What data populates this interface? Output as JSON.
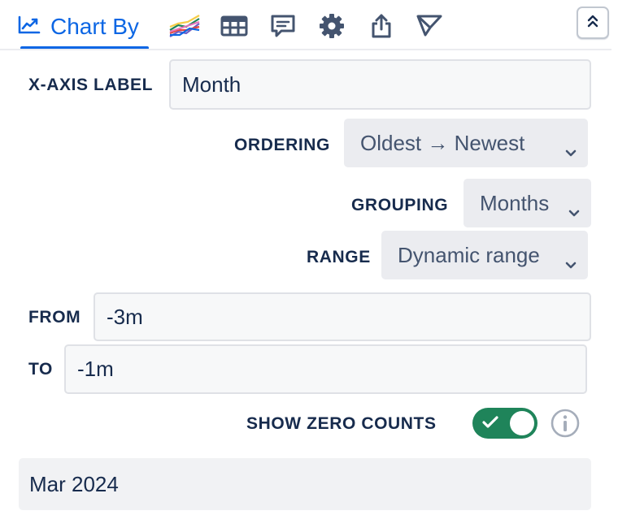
{
  "toolbar": {
    "active_tab_label": "Chart By",
    "icons": [
      "line-chart-icon",
      "multi-series-chart-icon",
      "table-icon",
      "comment-icon",
      "gear-icon",
      "share-icon",
      "filter-icon",
      "collapse-icon"
    ],
    "colors": {
      "accent": "#0c66e4",
      "series": [
        "#e2483d",
        "#f5cd47",
        "#1f845a",
        "#6e5dc6",
        "#0c66e4",
        "#e774bb"
      ]
    }
  },
  "form": {
    "x_axis_label": {
      "label": "X-AXIS LABEL",
      "value": "Month"
    },
    "ordering": {
      "label": "ORDERING",
      "value": "Oldest → Newest"
    },
    "grouping": {
      "label": "GROUPING",
      "value": "Months"
    },
    "range": {
      "label": "RANGE",
      "value": "Dynamic range"
    },
    "from": {
      "label": "FROM",
      "value": "-3m"
    },
    "to": {
      "label": "TO",
      "value": "-1m"
    },
    "show_zero_counts": {
      "label": "SHOW ZERO COUNTS",
      "enabled": true,
      "color": "#1f845a"
    }
  },
  "preview": {
    "text": "Mar 2024"
  }
}
